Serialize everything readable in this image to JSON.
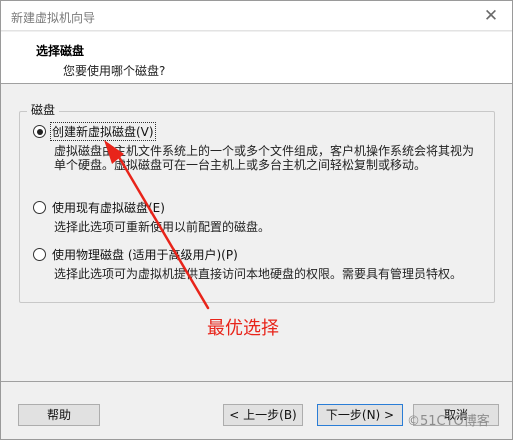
{
  "window": {
    "title": "新建虚拟机向导",
    "close_glyph": "✕"
  },
  "header": {
    "title": "选择磁盘",
    "subtitle": "您要使用哪个磁盘?"
  },
  "group": {
    "label": "磁盘"
  },
  "options": [
    {
      "label": "创建新虚拟磁盘(V)",
      "selected": true,
      "desc_lines": [
        "虚拟磁盘由主机文件系统上的一个或多个文件组成，客户机操作系统会将其视为",
        "单个硬盘。虚拟磁盘可在一台主机上或多台主机之间轻松复制或移动。"
      ]
    },
    {
      "label": "使用现有虚拟磁盘(E)",
      "selected": false,
      "desc_lines": [
        "选择此选项可重新使用以前配置的磁盘。"
      ]
    },
    {
      "label": "使用物理磁盘 (适用于高级用户)(P)",
      "selected": false,
      "desc_lines": [
        "选择此选项可为虚拟机提供直接访问本地硬盘的权限。需要具有管理员特权。"
      ]
    }
  ],
  "buttons": {
    "help": "帮助",
    "back": "< 上一步(B)",
    "next": "下一步(N) >",
    "cancel": "取消"
  },
  "annotation": {
    "text": "最优选择",
    "color": "#e8241a"
  },
  "watermark": "©51CTO博客"
}
